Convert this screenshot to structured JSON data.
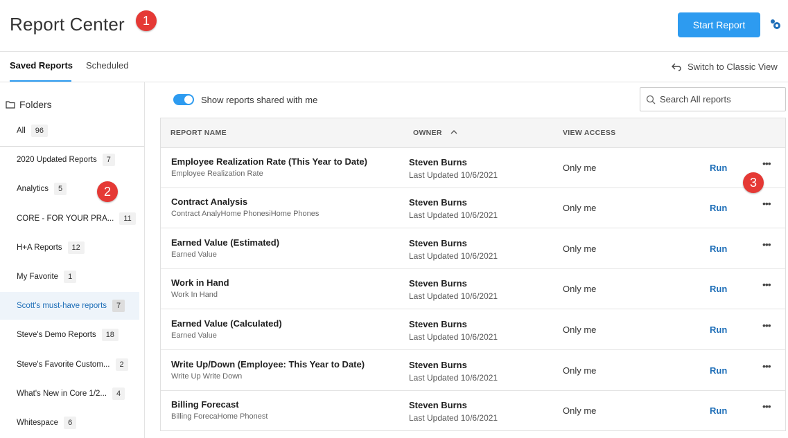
{
  "header": {
    "title": "Report Center",
    "start_label": "Start Report"
  },
  "callouts": [
    "1",
    "2",
    "3"
  ],
  "tabs": [
    {
      "label": "Saved Reports",
      "active": true
    },
    {
      "label": "Scheduled",
      "active": false
    }
  ],
  "classic_label": "Switch to Classic View",
  "sidebar": {
    "folders_label": "Folders",
    "all": {
      "label": "All",
      "count": "96"
    },
    "items": [
      {
        "label": "2020 Updated Reports",
        "count": "7"
      },
      {
        "label": "Analytics",
        "count": "5"
      },
      {
        "label": "CORE - FOR YOUR PRA...",
        "count": "11"
      },
      {
        "label": "H+A Reports",
        "count": "12"
      },
      {
        "label": "My Favorite",
        "count": "1"
      },
      {
        "label": "Scott's must-have reports",
        "count": "7",
        "selected": true
      },
      {
        "label": "Steve's Demo Reports",
        "count": "18"
      },
      {
        "label": "Steve's Favorite Custom...",
        "count": "2"
      },
      {
        "label": "What's New in Core 1/2...",
        "count": "4"
      },
      {
        "label": "Whitespace",
        "count": "6"
      }
    ]
  },
  "toggle_label": "Show reports shared with me",
  "search": {
    "placeholder": "Search All reports"
  },
  "table": {
    "headers": {
      "name": "REPORT NAME",
      "owner": "OWNER",
      "access": "VIEW ACCESS"
    },
    "rows": [
      {
        "name": "Employee Realization Rate (This Year to Date)",
        "sub": "Employee Realization Rate",
        "owner": "Steven Burns",
        "updated": "Last Updated 10/6/2021",
        "access": "Only me",
        "run": "Run"
      },
      {
        "name": "Contract Analysis",
        "sub": "Contract AnalyHome PhonesiHome Phones",
        "owner": "Steven Burns",
        "updated": "Last Updated 10/6/2021",
        "access": "Only me",
        "run": "Run"
      },
      {
        "name": "Earned Value (Estimated)",
        "sub": "Earned Value",
        "owner": "Steven Burns",
        "updated": "Last Updated 10/6/2021",
        "access": "Only me",
        "run": "Run"
      },
      {
        "name": "Work in Hand",
        "sub": "Work In Hand",
        "owner": "Steven Burns",
        "updated": "Last Updated 10/6/2021",
        "access": "Only me",
        "run": "Run"
      },
      {
        "name": "Earned Value (Calculated)",
        "sub": "Earned Value",
        "owner": "Steven Burns",
        "updated": "Last Updated 10/6/2021",
        "access": "Only me",
        "run": "Run"
      },
      {
        "name": "Write Up/Down (Employee: This Year to Date)",
        "sub": "Write Up Write Down",
        "owner": "Steven Burns",
        "updated": "Last Updated 10/6/2021",
        "access": "Only me",
        "run": "Run"
      },
      {
        "name": "Billing Forecast",
        "sub": "Billing ForecaHome Phonest",
        "owner": "Steven Burns",
        "updated": "Last Updated 10/6/2021",
        "access": "Only me",
        "run": "Run"
      }
    ]
  },
  "colors": {
    "accent": "#2d9bf0",
    "link": "#1f6fb8",
    "callout": "#e53935"
  },
  "icons": [
    "gear-icon",
    "back-arrow-icon",
    "folder-icon",
    "search-icon",
    "sort-up-icon",
    "more-icon"
  ]
}
